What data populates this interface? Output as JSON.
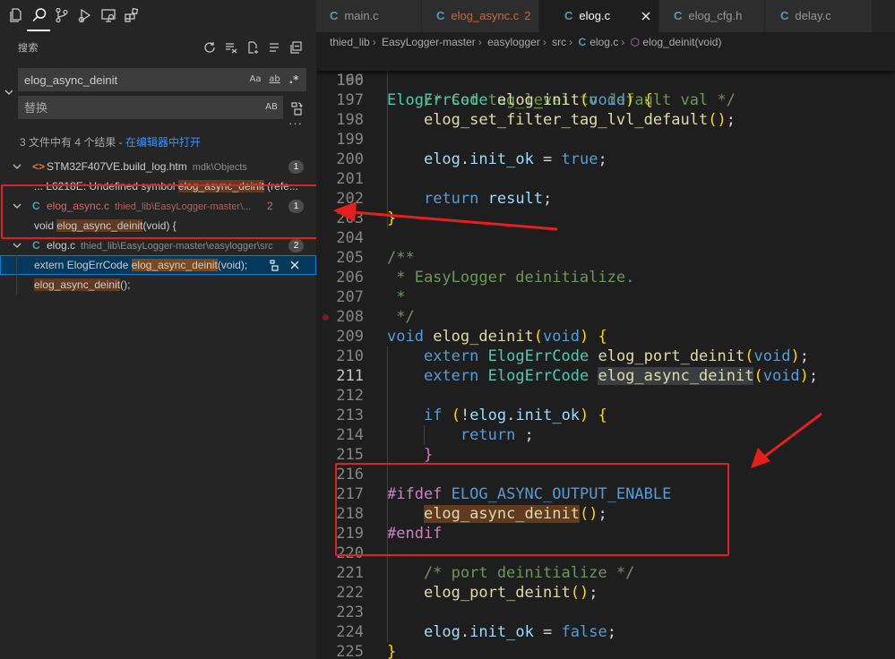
{
  "activity_bar": {
    "items": [
      {
        "name": "explorer-icon",
        "active": false
      },
      {
        "name": "search-icon",
        "active": true
      },
      {
        "name": "source-control-icon",
        "active": false
      },
      {
        "name": "run-debug-icon",
        "active": false
      },
      {
        "name": "remote-explorer-icon",
        "active": false
      },
      {
        "name": "extensions-icon",
        "active": false
      }
    ]
  },
  "search_panel": {
    "title": "搜索",
    "header_actions": [
      "refresh-icon",
      "clear-results-icon",
      "new-search-editor-icon",
      "collapse-all-icon",
      "view-as-tree-icon"
    ],
    "search_value": "elog_async_deinit",
    "search_options": {
      "match_case": "Aa",
      "match_word": "ab",
      "regex": ".*"
    },
    "replace_placeholder": "替换",
    "preserve_case": "AB",
    "summary_text": "3 文件中有 4 个结果 - ",
    "summary_link": "在编辑器中打开",
    "results": [
      {
        "file": "STM32F407VE.build_log.htm",
        "path": "mdk\\Objects",
        "count": "1",
        "type_icon": "html-file-icon",
        "matches": [
          {
            "pre": "... L6218E: Undefined symbol ",
            "hit": "elog_async_deinit",
            "post": " (refe..."
          }
        ]
      },
      {
        "file": "elog_async.c",
        "path": "thied_lib\\EasyLogger-master\\...",
        "modified_count": "2",
        "count": "1",
        "type_icon": "c-file-icon",
        "matches": [
          {
            "pre": "void ",
            "hit": "elog_async_deinit",
            "post": "(void) {"
          }
        ]
      },
      {
        "file": "elog.c",
        "path": "thied_lib\\EasyLogger-master\\easylogger\\src",
        "count": "2",
        "type_icon": "c-file-icon",
        "matches": [
          {
            "pre": "extern ElogErrCode ",
            "hit": "elog_async_deinit",
            "post": "(void);",
            "selected": true
          },
          {
            "pre": "",
            "hit": "elog_async_deinit",
            "post": "();"
          }
        ]
      }
    ]
  },
  "tabs": [
    {
      "label": "main.c",
      "active": false
    },
    {
      "label": "elog_async.c",
      "modified_count": "2",
      "active": false
    },
    {
      "label": "elog.c",
      "active": true
    },
    {
      "label": "elog_cfg.h",
      "active": false
    },
    {
      "label": "delay.c",
      "active": false
    }
  ],
  "breadcrumb": [
    "thied_lib",
    "EasyLogger-master",
    "easylogger",
    "src",
    "elog.c",
    "elog_deinit(void)"
  ],
  "editor": {
    "sticky": {
      "ln": "160",
      "code": "ElogErrCode elog_init(void) {"
    },
    "current_line": "211",
    "breakpoint_line": "208",
    "lines": [
      {
        "ln": "196",
        "code": ""
      },
      {
        "ln": "197",
        "code": "    /* set tag_level to default val */"
      },
      {
        "ln": "198",
        "code": "    elog_set_filter_tag_lvl_default();"
      },
      {
        "ln": "199",
        "code": ""
      },
      {
        "ln": "200",
        "code": "    elog.init_ok = true;"
      },
      {
        "ln": "201",
        "code": ""
      },
      {
        "ln": "202",
        "code": "    return result;"
      },
      {
        "ln": "203",
        "code": "}"
      },
      {
        "ln": "204",
        "code": ""
      },
      {
        "ln": "205",
        "code": "/**"
      },
      {
        "ln": "206",
        "code": " * EasyLogger deinitialize."
      },
      {
        "ln": "207",
        "code": " *"
      },
      {
        "ln": "208",
        "code": " */"
      },
      {
        "ln": "209",
        "code": "void elog_deinit(void) {"
      },
      {
        "ln": "210",
        "code": "    extern ElogErrCode elog_port_deinit(void);"
      },
      {
        "ln": "211",
        "code": "    extern ElogErrCode elog_async_deinit(void);"
      },
      {
        "ln": "212",
        "code": ""
      },
      {
        "ln": "213",
        "code": "    if (!elog.init_ok) {"
      },
      {
        "ln": "214",
        "code": "        return ;"
      },
      {
        "ln": "215",
        "code": "    }"
      },
      {
        "ln": "216",
        "code": ""
      },
      {
        "ln": "217",
        "code": "#ifdef ELOG_ASYNC_OUTPUT_ENABLE"
      },
      {
        "ln": "218",
        "code": "    elog_async_deinit();"
      },
      {
        "ln": "219",
        "code": "#endif"
      },
      {
        "ln": "220",
        "code": ""
      },
      {
        "ln": "221",
        "code": "    /* port deinitialize */"
      },
      {
        "ln": "222",
        "code": "    elog_port_deinit();"
      },
      {
        "ln": "223",
        "code": ""
      },
      {
        "ln": "224",
        "code": "    elog.init_ok = false;"
      },
      {
        "ln": "225",
        "code": "}"
      }
    ]
  },
  "colors": {
    "annotation_red": "#e51e1e",
    "match_highlight": "#613a1f",
    "selection_blue": "#04395e",
    "link_blue": "#3794ff"
  }
}
